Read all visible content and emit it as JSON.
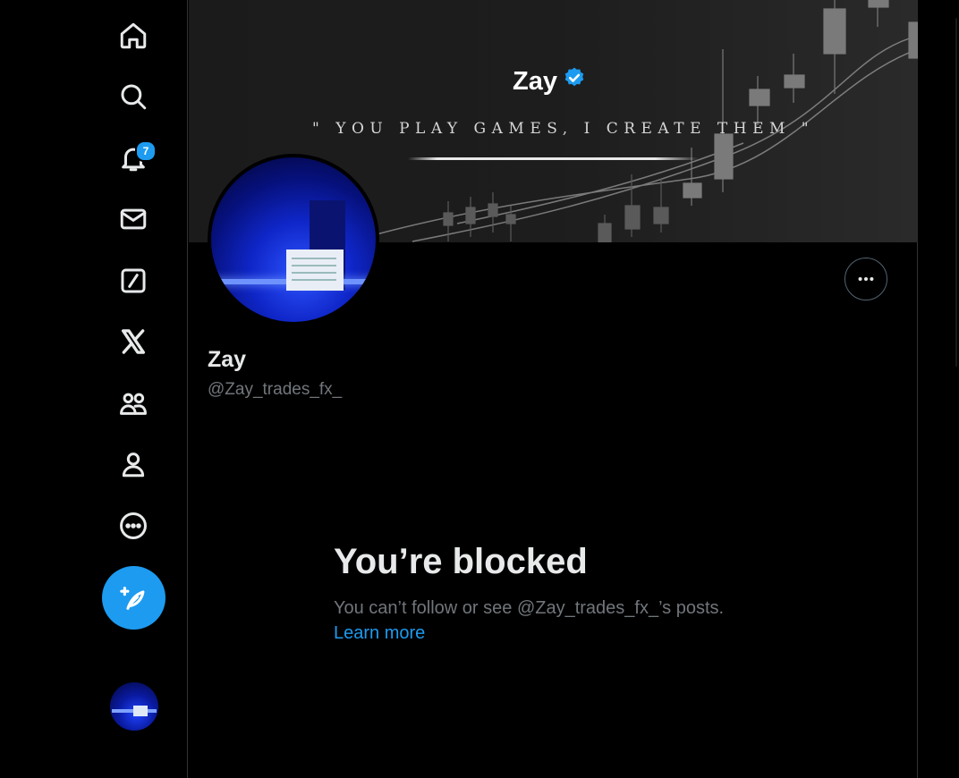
{
  "nav": {
    "items": [
      {
        "name": "home",
        "icon": "home-icon"
      },
      {
        "name": "explore",
        "icon": "search-icon"
      },
      {
        "name": "notifications",
        "icon": "bell-icon",
        "badge": "7"
      },
      {
        "name": "messages",
        "icon": "envelope-icon"
      },
      {
        "name": "grok",
        "icon": "grok-slash-icon"
      },
      {
        "name": "premium",
        "icon": "x-logo-icon"
      },
      {
        "name": "communities",
        "icon": "people-icon"
      },
      {
        "name": "profile",
        "icon": "person-icon"
      },
      {
        "name": "more",
        "icon": "more-circle-icon"
      }
    ],
    "compose_icon": "feather-plus-icon"
  },
  "banner": {
    "title": "Zay",
    "quote": "\" YOU PLAY GAMES, I CREATE THEM \""
  },
  "profile": {
    "display_name": "Zay",
    "handle": "@Zay_trades_fx_"
  },
  "blocked": {
    "title": "You’re blocked",
    "description": "You can’t follow or see @Zay_trades_fx_’s posts.",
    "link": "Learn more"
  },
  "colors": {
    "accent": "#1d9bf0",
    "background": "#000000",
    "muted_text": "#71767b",
    "text": "#e7e9ea"
  }
}
